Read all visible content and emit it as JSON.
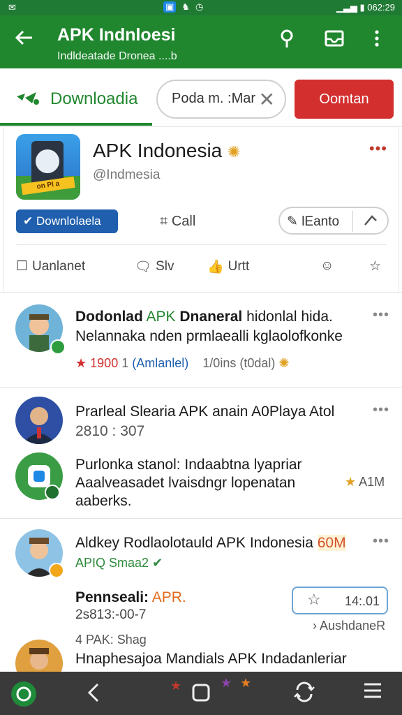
{
  "status_bar": {
    "time": "062:29"
  },
  "app_bar": {
    "title": "APK Indnloesi",
    "subtitle": "Indldeatade Dronea ....b"
  },
  "toolbar": {
    "tab_label": "Downloadia",
    "search_value": "Poda m. :Mar",
    "red_button": "Oomtan"
  },
  "profile": {
    "name": "APK Indonesia",
    "handle": "@Indmesia",
    "icon_banner": "on Pl a",
    "download_button": "Downlolaela",
    "call_label": "Call",
    "pill_label": "lEanto",
    "actions": [
      "Uanlanet",
      "Slv",
      "Urtt"
    ]
  },
  "posts": [
    {
      "title_parts": [
        "Dodonlad",
        "APK",
        "Dnaneral",
        "hidonlal hida."
      ],
      "line2": "Nelannaka nden prmlaealli kglaolofkonke",
      "stat_red": "1900",
      "stat_sep": "1",
      "stat_link": "(Amlanlel)",
      "stat_gray": "1/0ins (t0dal)"
    },
    {
      "title": "Prarleal Slearia APK anain A0Playa Atol",
      "meta": "2810 : 307",
      "body": [
        "Purlonka stanol: Indaabtna lyapriar",
        "Aaalveasadet lvaisdngr lopenatan",
        "aaberks."
      ],
      "stat": "A1M"
    },
    {
      "title": "Aldkey Rodlaolotauld APK Indonesia",
      "title_tag": "60M",
      "sub": "APIQ Smaa2",
      "label_a": "Pennseali:",
      "label_b": "APR.",
      "meta": "2s813:-00-7",
      "pill_value": "14:.01",
      "link": "AushdaneR"
    },
    {
      "tag": "4 PAK: Shag",
      "title": "Hnaphesajoa Mandials APK Indadanleriar"
    }
  ],
  "colors": {
    "primary": "#21872f",
    "danger": "#d32f2f",
    "link": "#1f5fae"
  }
}
